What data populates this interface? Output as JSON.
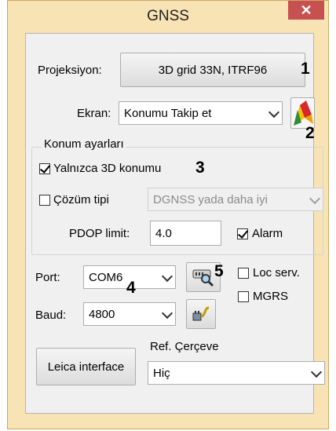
{
  "window": {
    "title": "GNSS",
    "close_glyph": "✕"
  },
  "projection": {
    "label": "Projeksiyon:",
    "button_text": "3D grid  33N, ITRF96"
  },
  "display": {
    "label": "Ekran:",
    "selected": "Konumu Takip et",
    "icon": "map-layers-icon"
  },
  "position_settings": {
    "group_label": "Konum ayarları",
    "only_3d": {
      "label": "Yalnızca 3D konumu",
      "checked": true
    },
    "solution_type": {
      "label": "Çözüm tipi",
      "checked": false,
      "selected": "DGNSS yada daha iyi",
      "enabled": false
    },
    "pdop": {
      "label": "PDOP limit:",
      "value": "4.0"
    },
    "alarm": {
      "label": "Alarm",
      "checked": true
    }
  },
  "port": {
    "label": "Port:",
    "selected": "COM6",
    "icon": "port-search-icon"
  },
  "baud": {
    "label": "Baud:",
    "selected": "4800",
    "icon": "connect-icon"
  },
  "loc_serv": {
    "label": "Loc serv.",
    "checked": false
  },
  "mgrs": {
    "label": "MGRS",
    "checked": false
  },
  "leica": {
    "label": "Leica interface"
  },
  "ref_frame": {
    "label": "Ref. Çerçeve",
    "selected": "Hiç"
  },
  "annotations": [
    "1",
    "2",
    "3",
    "4",
    "5"
  ],
  "colors": {
    "frame": "#f7e3b3",
    "close": "#c75050",
    "client": "#f0f0f0"
  }
}
